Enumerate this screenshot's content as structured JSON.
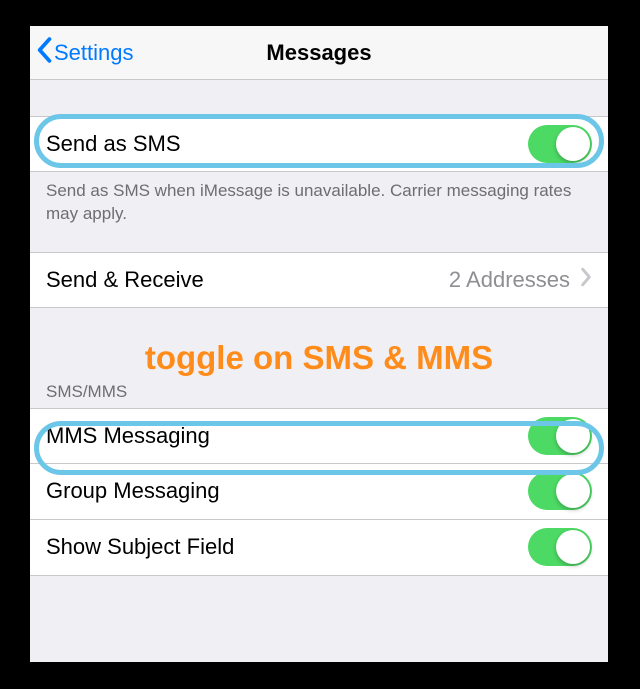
{
  "nav": {
    "back_label": "Settings",
    "title": "Messages"
  },
  "rows": {
    "send_as_sms": "Send as SMS",
    "send_as_sms_footer": "Send as SMS when iMessage is unavailable. Carrier messaging rates may apply.",
    "send_receive": "Send & Receive",
    "send_receive_value": "2 Addresses",
    "sms_mms_header": "SMS/MMS",
    "mms_messaging": "MMS Messaging",
    "group_messaging": "Group Messaging",
    "show_subject": "Show Subject Field"
  },
  "annotation": "toggle on SMS & MMS",
  "toggles": {
    "send_as_sms": true,
    "mms_messaging": true,
    "group_messaging": true,
    "show_subject": true
  }
}
